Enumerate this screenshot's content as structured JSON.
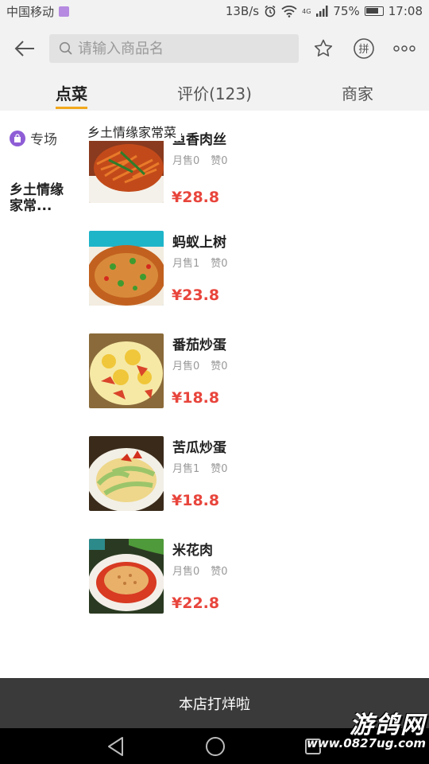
{
  "status_bar": {
    "carrier": "中国移动",
    "speed": "13B/s",
    "network": "4G",
    "battery": "75%",
    "time": "17:08"
  },
  "search": {
    "placeholder": "请输入商品名"
  },
  "tabs": [
    {
      "label": "点菜"
    },
    {
      "label": "评价(123)"
    },
    {
      "label": "商家"
    }
  ],
  "sidebar": {
    "special_label": "专场",
    "category_label": "乡土情缘家常..."
  },
  "section_title": "乡土情缘家常菜",
  "dishes": [
    {
      "name": "鱼香肉丝",
      "monthly_sales": "月售0",
      "likes": "赞0",
      "price": "¥28.8"
    },
    {
      "name": "蚂蚁上树",
      "monthly_sales": "月售1",
      "likes": "赞0",
      "price": "¥23.8"
    },
    {
      "name": "番茄炒蛋",
      "monthly_sales": "月售0",
      "likes": "赞0",
      "price": "¥18.8"
    },
    {
      "name": "苦瓜炒蛋",
      "monthly_sales": "月售1",
      "likes": "赞0",
      "price": "¥18.8"
    },
    {
      "name": "米花肉",
      "monthly_sales": "月售0",
      "likes": "赞0",
      "price": "¥22.8"
    }
  ],
  "bottom_bar": {
    "label": "本店打烊啦"
  },
  "watermark": {
    "title": "游鸽网",
    "url": "www.0827ug.com"
  },
  "colors": {
    "accent": "#f2a81d",
    "price": "#e8453c",
    "special_icon": "#8e5dd6",
    "bottom_bar": "#3a3a3a"
  }
}
